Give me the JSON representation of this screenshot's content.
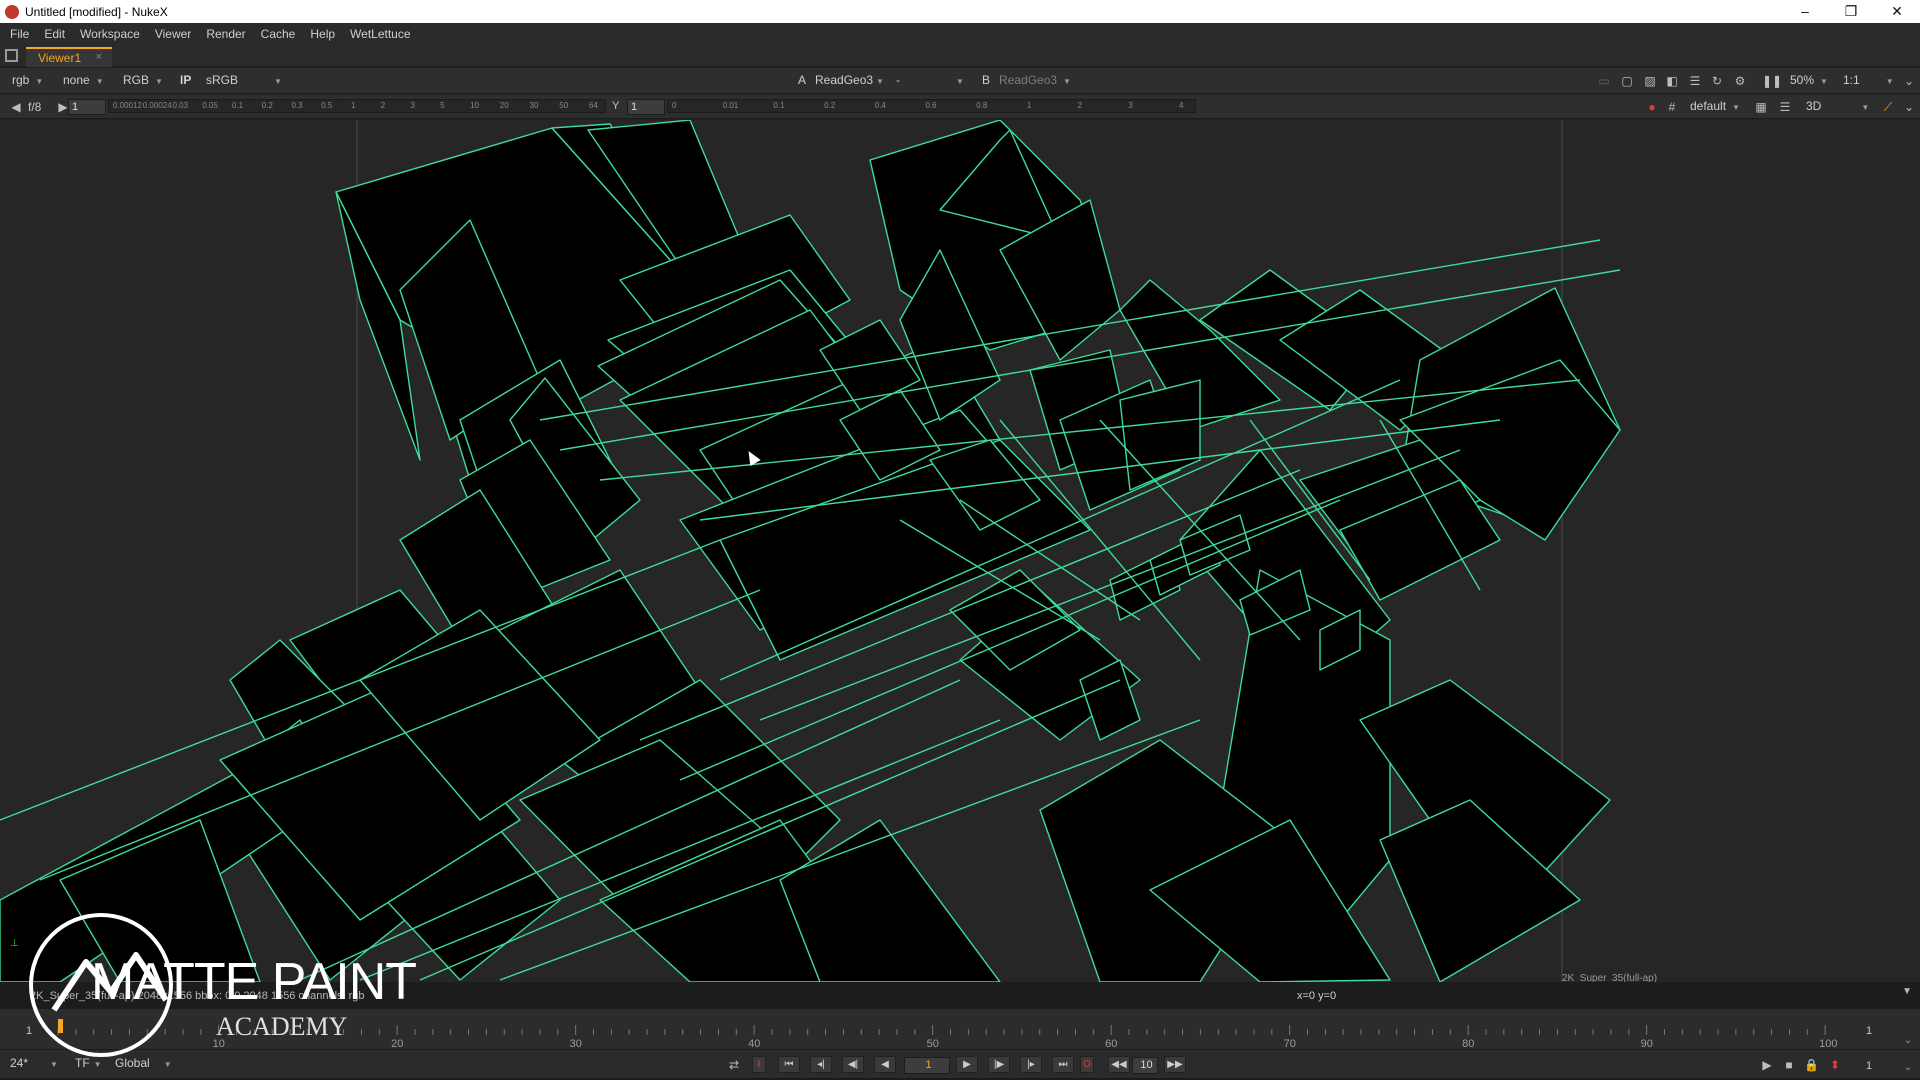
{
  "window": {
    "title": "Untitled [modified] - NukeX",
    "minimize": "–",
    "restore": "❐",
    "close": "✕"
  },
  "menu": [
    "File",
    "Edit",
    "Workspace",
    "Viewer",
    "Render",
    "Cache",
    "Help",
    "WetLettuce"
  ],
  "tab": {
    "label": "Viewer1",
    "close": "×"
  },
  "toolbar1": {
    "channels": "rgb",
    "channel_none": "none",
    "display_channel": "RGB",
    "ip": "IP",
    "lut": "sRGB",
    "input_a_label": "A",
    "input_a": "ReadGeo3",
    "input_a_mode": "-",
    "input_b_label": "B",
    "input_b": "ReadGeo3",
    "zoom": "50%",
    "ratio": "1:1"
  },
  "toolbar2": {
    "fstop": "f/8",
    "gain_value": "1",
    "gain_ticks": [
      "0.00012",
      "0.00024",
      "0.03",
      "0.05",
      "0.1",
      "0.2",
      "0.3",
      "0.5",
      "1",
      "2",
      "3",
      "5",
      "10",
      "20",
      "30",
      "50",
      "64"
    ],
    "gamma_label": "Y",
    "gamma_value": "1",
    "gamma_ticks": [
      "0",
      "0.01",
      "0.1",
      "0.2",
      "0.4",
      "0.6",
      "0.8",
      "1",
      "2",
      "3",
      "4"
    ],
    "camera": "default",
    "view_mode": "3D"
  },
  "viewer": {
    "format_label": "2K_Super_35(full-ap)"
  },
  "infobar": {
    "left": "2K_Super_35(full-ap) 2048x1556 bbox: 0 0 2048 1556 channels: rgb",
    "coords": "x=0 y=0"
  },
  "timeline": {
    "start": "1",
    "end": "1",
    "labels": [
      "10",
      "20",
      "30",
      "40",
      "50",
      "60",
      "70",
      "80",
      "90",
      "100"
    ]
  },
  "playback": {
    "fps": "24*",
    "tf": "TF",
    "scope": "Global",
    "frame": "1",
    "increment": "10",
    "end_frame": "1"
  },
  "logo": {
    "line1": "MATTE PAINT",
    "line2": "ACADEMY"
  },
  "colors": {
    "accent": "#f5a623",
    "wire": "#3ddc97",
    "background": "#262626"
  }
}
